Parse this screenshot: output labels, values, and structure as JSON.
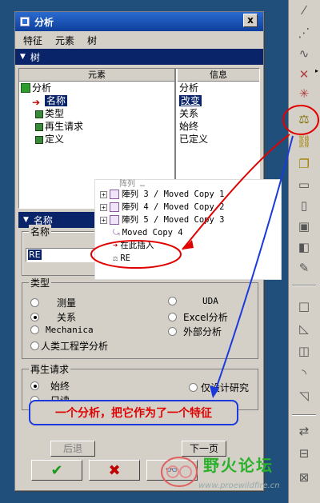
{
  "dialog": {
    "title": "分析",
    "close_label": "x",
    "menu": [
      "特征",
      "元素",
      "树"
    ]
  },
  "tree_section": {
    "header": "树",
    "col_element": "元素",
    "col_info": "信息",
    "rows": [
      {
        "label": "分析"
      },
      {
        "label": "名称"
      },
      {
        "label": "类型"
      },
      {
        "label": "再生请求"
      },
      {
        "label": "定义"
      }
    ],
    "info": [
      "分析",
      "改变",
      "关系",
      "始终",
      "已定义"
    ]
  },
  "name_section": {
    "header": "名称",
    "group_label": "名称",
    "value": "RE"
  },
  "type_group": {
    "label": "类型",
    "options": [
      "测量",
      "关系",
      "Mechanica",
      "人类工程学分析",
      "UDA",
      "Excel分析",
      "外部分析"
    ],
    "selected": "关系"
  },
  "regen_group": {
    "label": "再生请求",
    "options": [
      "始终",
      "只读",
      "仅设计研究"
    ],
    "selected": "始终"
  },
  "buttons": {
    "back": "后退",
    "next": "下一页",
    "ok": "✔",
    "cancel": "✖"
  },
  "popup_tree": {
    "rows": [
      "陣列 3 / Moved Copy 1",
      "陣列 4 / Moved Copy 2",
      "陣列 5 / Moved Copy 3",
      "Moved Copy 4",
      "在此插入",
      "RE"
    ],
    "cut_top": "阵列 …"
  },
  "callout": "一个分析，把它作为了一个特征",
  "watermark": {
    "title": "野火论坛",
    "url": "www.proewildfire.cn"
  },
  "colors": {
    "title_bar": "#0e3f9c",
    "selection": "#0a246a",
    "annotation_red": "#e00000",
    "annotation_blue": "#1a3adb"
  }
}
